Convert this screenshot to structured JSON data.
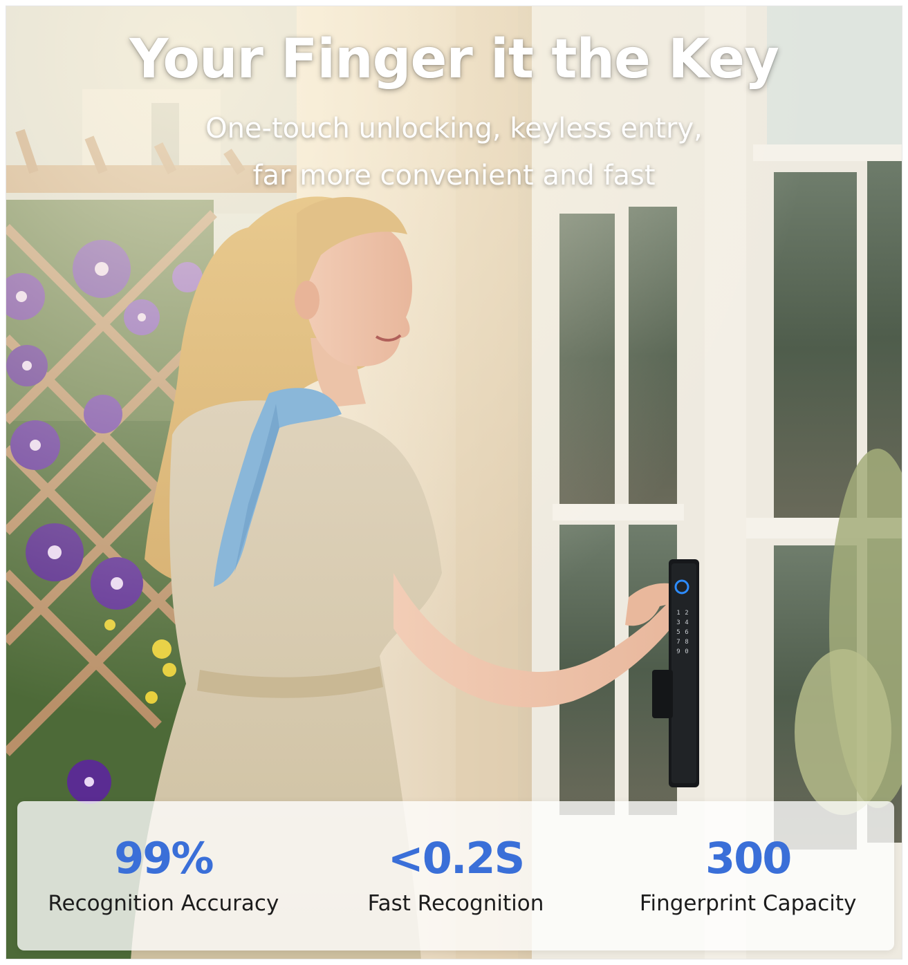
{
  "headline": {
    "title": "Your Finger it the Key",
    "subtitle_line1": "One-touch unlocking, keyless entry,",
    "subtitle_line2": "far more convenient and fast"
  },
  "stats": [
    {
      "value": "99%",
      "label": "Recognition Accuracy"
    },
    {
      "value": "<0.2S",
      "label": "Fast Recognition"
    },
    {
      "value": "300",
      "label": "Fingerprint Capacity"
    }
  ],
  "keypad_digits": [
    "1",
    "2",
    "3",
    "4",
    "5",
    "6",
    "7",
    "8",
    "9",
    "0"
  ],
  "colors": {
    "accent": "#3a6fd8",
    "headline": "#ffffff",
    "label": "#1c1c1c",
    "lock_body": "#16181b",
    "fingerprint_ring": "#2d8cff"
  }
}
